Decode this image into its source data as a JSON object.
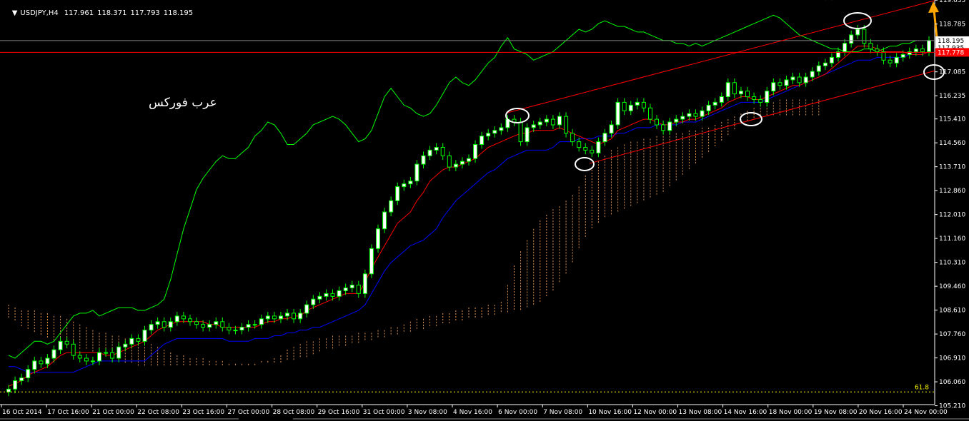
{
  "header": {
    "symbol": "USDJPY,H4",
    "open": "117.961",
    "high": "118.371",
    "low": "117.793",
    "close": "118.195"
  },
  "watermark": "عرب فوركس",
  "fib_label": "61.8",
  "colors": {
    "background": "#000000",
    "bull_candle": "#ffffff",
    "bear_candle": "#000000",
    "wick": "#00ff00",
    "tenkan": "#ff0000",
    "kijun": "#0000ff",
    "chikou": "#00ff00",
    "cloud_a": "#f4a460",
    "cloud_b": "#f0e6d2",
    "channel": "#ff0000",
    "fib": "#ffff00",
    "arrow": "#ffa500",
    "price_tag_red": "#ff0000"
  },
  "chart_data": {
    "type": "candlestick",
    "symbol": "USDJPY",
    "timeframe": "H4",
    "ylim": [
      105.25,
      119.64
    ],
    "price_ticks": [
      "119.635",
      "118.785",
      "117.935",
      "117.085",
      "116.235",
      "115.410",
      "114.560",
      "113.710",
      "112.860",
      "112.010",
      "111.160",
      "110.310",
      "109.460",
      "108.610",
      "107.760",
      "106.910",
      "106.060",
      "105.210"
    ],
    "price_tags": [
      {
        "label": "118.195",
        "value": 118.195,
        "style": "white"
      },
      {
        "label": "117.935",
        "value": 117.935,
        "style": "white"
      },
      {
        "label": "117.778",
        "value": 117.778,
        "style": "red"
      }
    ],
    "time_labels": [
      "16 Oct 2014",
      "17 Oct 16:00",
      "21 Oct 00:00",
      "22 Oct 08:00",
      "23 Oct 16:00",
      "27 Oct 00:00",
      "28 Oct 08:00",
      "29 Oct 16:00",
      "31 Oct 00:00",
      "3 Nov 08:00",
      "4 Nov 16:00",
      "6 Nov 00:00",
      "7 Nov 08:00",
      "10 Nov 16:00",
      "12 Nov 00:00",
      "13 Nov 08:00",
      "14 Nov 16:00",
      "18 Nov 00:00",
      "19 Nov 08:00",
      "20 Nov 16:00",
      "24 Nov 00:00"
    ],
    "horizontal_lines": [
      {
        "value": 117.778,
        "color": "red"
      },
      {
        "value": 118.195,
        "color": "gray"
      },
      {
        "value": 105.7,
        "color": "yellow",
        "dashed": true,
        "label": "61.8"
      }
    ],
    "channel_lines": [
      {
        "from": [
          0.5225,
          115.62
        ],
        "to": [
          0.9645,
          119.62
        ]
      },
      {
        "from": [
          0.6085,
          113.83
        ],
        "to": [
          0.9645,
          117.12
        ]
      }
    ],
    "closes": [
      105.8,
      106.1,
      106.2,
      106.5,
      106.8,
      106.7,
      106.9,
      107.2,
      107.5,
      107.4,
      107.0,
      106.9,
      106.8,
      106.8,
      107.1,
      107.1,
      106.9,
      107.3,
      107.4,
      107.6,
      107.5,
      107.9,
      108.1,
      108.2,
      108.0,
      108.2,
      108.4,
      108.3,
      108.2,
      108.1,
      108.0,
      108.1,
      108.2,
      108.0,
      107.9,
      107.9,
      108.0,
      108.1,
      108.1,
      108.3,
      108.4,
      108.3,
      108.4,
      108.5,
      108.3,
      108.5,
      108.8,
      109.0,
      109.1,
      109.2,
      109.1,
      109.3,
      109.4,
      109.5,
      109.2,
      109.9,
      110.8,
      111.5,
      112.1,
      112.5,
      113.0,
      113.1,
      113.2,
      113.8,
      114.1,
      114.3,
      114.4,
      114.1,
      113.7,
      113.8,
      113.9,
      114.0,
      114.5,
      114.8,
      114.9,
      115.0,
      115.1,
      115.4,
      115.3,
      114.6,
      115.1,
      115.2,
      115.3,
      115.4,
      115.2,
      115.5,
      114.9,
      114.6,
      114.4,
      114.3,
      114.2,
      114.6,
      114.9,
      115.2,
      116.0,
      115.7,
      115.9,
      116.0,
      115.8,
      115.4,
      115.2,
      115.0,
      115.3,
      115.4,
      115.5,
      115.6,
      115.5,
      115.7,
      115.9,
      116.0,
      116.2,
      116.7,
      116.3,
      116.4,
      116.2,
      116.1,
      116.0,
      116.4,
      116.7,
      116.6,
      116.8,
      116.9,
      116.7,
      116.9,
      117.1,
      117.3,
      117.4,
      117.6,
      117.8,
      118.1,
      118.4,
      118.6,
      118.1,
      117.9,
      117.8,
      117.5,
      117.4,
      117.6,
      117.7,
      117.8,
      117.9,
      117.8,
      118.2
    ],
    "tenkan": [
      105.9,
      106.0,
      106.1,
      106.3,
      106.4,
      106.5,
      106.6,
      106.8,
      107.0,
      107.1,
      107.1,
      107.1,
      107.1,
      107.1,
      107.1,
      107.0,
      107.0,
      107.1,
      107.2,
      107.3,
      107.4,
      107.5,
      107.7,
      107.9,
      108.0,
      108.1,
      108.2,
      108.2,
      108.2,
      108.2,
      108.2,
      108.1,
      108.1,
      108.0,
      108.0,
      108.0,
      108.0,
      108.0,
      108.0,
      108.1,
      108.2,
      108.2,
      108.3,
      108.3,
      108.4,
      108.4,
      108.6,
      108.7,
      108.8,
      108.9,
      109.0,
      109.1,
      109.2,
      109.2,
      109.2,
      109.6,
      110.1,
      110.5,
      110.9,
      111.3,
      111.7,
      111.9,
      112.1,
      112.5,
      112.8,
      113.2,
      113.4,
      113.6,
      113.7,
      113.7,
      113.8,
      113.9,
      114.0,
      114.2,
      114.4,
      114.5,
      114.6,
      114.7,
      114.8,
      114.9,
      114.9,
      115.0,
      115.0,
      115.0,
      115.0,
      115.1,
      115.0,
      114.9,
      114.8,
      114.7,
      114.6,
      114.5,
      114.6,
      114.7,
      115.0,
      115.1,
      115.2,
      115.3,
      115.4,
      115.4,
      115.3,
      115.2,
      115.2,
      115.3,
      115.3,
      115.4,
      115.4,
      115.5,
      115.6,
      115.7,
      115.8,
      116.0,
      116.1,
      116.2,
      116.2,
      116.1,
      116.1,
      116.2,
      116.3,
      116.4,
      116.5,
      116.6,
      116.6,
      116.7,
      116.8,
      116.9,
      117.0,
      117.2,
      117.4,
      117.6,
      117.8,
      118.0,
      118.0,
      118.0,
      117.9,
      117.8,
      117.8,
      117.8,
      117.8,
      117.7,
      117.7,
      117.7,
      117.8
    ],
    "kijun": [
      106.6,
      106.6,
      106.5,
      106.4,
      106.4,
      106.4,
      106.4,
      106.4,
      106.4,
      106.4,
      106.4,
      106.5,
      106.6,
      106.7,
      106.8,
      106.8,
      106.8,
      106.8,
      106.8,
      106.8,
      106.8,
      106.8,
      107.0,
      107.2,
      107.4,
      107.5,
      107.6,
      107.6,
      107.6,
      107.6,
      107.6,
      107.6,
      107.6,
      107.6,
      107.5,
      107.5,
      107.5,
      107.5,
      107.6,
      107.6,
      107.6,
      107.7,
      107.7,
      107.8,
      107.8,
      107.9,
      107.9,
      108.0,
      108.0,
      108.1,
      108.2,
      108.3,
      108.4,
      108.5,
      108.6,
      108.8,
      109.2,
      109.6,
      110.0,
      110.3,
      110.5,
      110.7,
      110.9,
      111.0,
      111.1,
      111.3,
      111.5,
      111.9,
      112.2,
      112.5,
      112.7,
      112.9,
      113.1,
      113.3,
      113.5,
      113.6,
      113.8,
      114.0,
      114.1,
      114.2,
      114.3,
      114.3,
      114.3,
      114.3,
      114.4,
      114.6,
      114.6,
      114.6,
      114.7,
      114.7,
      114.7,
      114.8,
      114.8,
      114.8,
      114.9,
      114.9,
      115.0,
      115.1,
      115.1,
      115.1,
      115.2,
      115.2,
      115.2,
      115.2,
      115.3,
      115.3,
      115.3,
      115.4,
      115.5,
      115.6,
      115.7,
      115.8,
      115.9,
      116.0,
      116.0,
      116.0,
      116.0,
      116.1,
      116.2,
      116.3,
      116.4,
      116.5,
      116.6,
      116.7,
      116.8,
      116.9,
      117.0,
      117.1,
      117.2,
      117.3,
      117.4,
      117.5,
      117.5,
      117.5,
      117.6,
      117.6,
      117.6,
      117.6,
      117.6,
      117.7,
      117.7,
      117.7,
      117.8
    ],
    "chikou": [
      107.0,
      106.9,
      107.1,
      107.3,
      107.5,
      107.5,
      107.4,
      107.5,
      107.8,
      108.1,
      108.4,
      108.5,
      108.5,
      108.6,
      108.4,
      108.5,
      108.6,
      108.7,
      108.7,
      108.7,
      108.6,
      108.6,
      108.7,
      108.8,
      109.0,
      109.7,
      110.6,
      111.5,
      112.2,
      112.9,
      113.3,
      113.6,
      113.9,
      114.1,
      114.0,
      114.0,
      114.2,
      114.4,
      114.8,
      115.0,
      115.3,
      115.2,
      114.9,
      114.5,
      114.5,
      114.7,
      114.9,
      115.2,
      115.3,
      115.4,
      115.5,
      115.4,
      115.2,
      114.9,
      114.6,
      114.7,
      115.0,
      115.6,
      116.2,
      116.5,
      116.2,
      115.9,
      115.8,
      115.6,
      115.5,
      115.6,
      115.9,
      116.3,
      116.7,
      116.9,
      116.7,
      116.6,
      116.8,
      117.1,
      117.4,
      117.6,
      118.0,
      118.3,
      117.9,
      117.8,
      117.7,
      117.5,
      117.6,
      117.7,
      117.8,
      118.0,
      118.2,
      118.4,
      118.6,
      118.5,
      118.6,
      118.8,
      118.9,
      118.8,
      118.7,
      118.7,
      118.6,
      118.5,
      118.5,
      118.4,
      118.3,
      118.2,
      118.2,
      118.1,
      118.1,
      118.0,
      118.1,
      118.0,
      118.1,
      118.2,
      118.3,
      118.4,
      118.5,
      118.6,
      118.7,
      118.8,
      118.9,
      119.0,
      119.1,
      119.0,
      118.8,
      118.6,
      118.4,
      118.3,
      118.2,
      118.1,
      118.0,
      117.9,
      117.9,
      117.8,
      117.8,
      117.8,
      117.9,
      117.9,
      117.8,
      117.9,
      118.0,
      118.0,
      118.1,
      118.1,
      118.2
    ],
    "cloud_upper": [
      108.8,
      108.7,
      108.6,
      108.6,
      108.6,
      108.5,
      108.5,
      108.4,
      108.4,
      108.3,
      108.2,
      108.1,
      108.0,
      107.9,
      107.8,
      107.8,
      107.7,
      107.7,
      107.6,
      107.6,
      107.6,
      107.5,
      107.4,
      107.3,
      107.2,
      107.1,
      107.0,
      107.0,
      106.9,
      106.9,
      106.9,
      106.8,
      106.8,
      106.8,
      106.7,
      106.7,
      106.7,
      106.7,
      106.7,
      106.8,
      106.8,
      106.9,
      107.0,
      107.2,
      107.3,
      107.4,
      107.5,
      107.5,
      107.6,
      107.6,
      107.7,
      107.7,
      107.7,
      107.7,
      107.8,
      107.8,
      107.8,
      107.9,
      107.9,
      108.0,
      108.0,
      108.1,
      108.2,
      108.3,
      108.3,
      108.4,
      108.4,
      108.5,
      108.5,
      108.6,
      108.6,
      108.7,
      108.7,
      108.7,
      108.8,
      108.8,
      108.9,
      109.5,
      110.2,
      110.7,
      111.1,
      111.5,
      111.8,
      112.0,
      112.2,
      112.3,
      112.5,
      112.7,
      113.0,
      113.4,
      113.7,
      113.9,
      114.1,
      114.3,
      114.4,
      114.5,
      114.6,
      114.6,
      114.7,
      114.7,
      114.8,
      114.8,
      114.9,
      114.9,
      114.9,
      115.0,
      115.0,
      115.1,
      115.1,
      115.2,
      115.3,
      115.4,
      115.5,
      115.6,
      115.7,
      115.8,
      115.9,
      116.0,
      116.0,
      116.1,
      116.1,
      116.1,
      116.1,
      116.1,
      116.1,
      116.1,
      116.1,
      116.1
    ],
    "cloud_lower": [
      108.3,
      108.2,
      108.0,
      107.9,
      107.8,
      107.7,
      107.6,
      107.5,
      107.4,
      107.3,
      107.3,
      107.2,
      107.2,
      107.1,
      107.1,
      107.0,
      106.9,
      106.8,
      106.7,
      106.7,
      106.6,
      106.6,
      106.6,
      106.6,
      106.6,
      106.6,
      106.6,
      106.6,
      106.6,
      106.6,
      106.6,
      106.6,
      106.6,
      106.6,
      106.6,
      106.6,
      106.6,
      106.6,
      106.6,
      106.7,
      106.7,
      106.7,
      106.7,
      106.8,
      106.8,
      106.9,
      106.9,
      107.0,
      107.1,
      107.2,
      107.2,
      107.3,
      107.3,
      107.4,
      107.4,
      107.5,
      107.5,
      107.6,
      107.6,
      107.7,
      107.7,
      107.8,
      107.8,
      107.9,
      107.9,
      108.0,
      108.0,
      108.1,
      108.1,
      108.2,
      108.2,
      108.3,
      108.3,
      108.3,
      108.4,
      108.4,
      108.5,
      108.5,
      108.6,
      108.6,
      108.7,
      108.8,
      108.9,
      109.1,
      109.3,
      109.6,
      109.9,
      110.3,
      110.8,
      111.2,
      111.5,
      111.7,
      111.9,
      112.0,
      112.1,
      112.2,
      112.3,
      112.4,
      112.5,
      112.6,
      112.7,
      112.8,
      113.0,
      113.2,
      113.4,
      113.6,
      113.8,
      114.0,
      114.2,
      114.4,
      114.6,
      114.8,
      115.0,
      115.2,
      115.3,
      115.4,
      115.5,
      115.5,
      115.5,
      115.5,
      115.5,
      115.5,
      115.5,
      115.5,
      115.5,
      115.5
    ]
  }
}
